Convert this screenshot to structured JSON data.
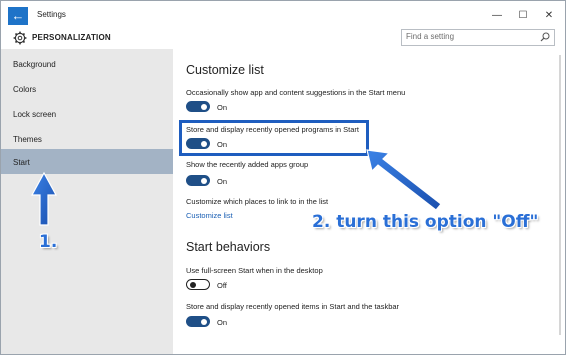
{
  "window": {
    "title": "Settings",
    "controls": {
      "minimize": "—",
      "maximize": "☐",
      "close": "✕"
    }
  },
  "header": {
    "title": "PERSONALIZATION",
    "search_placeholder": "Find a setting"
  },
  "sidebar": {
    "items": [
      {
        "label": "Background"
      },
      {
        "label": "Colors"
      },
      {
        "label": "Lock screen"
      },
      {
        "label": "Themes"
      },
      {
        "label": "Start",
        "active": true
      }
    ]
  },
  "main": {
    "customize_title": "Customize list",
    "settings": [
      {
        "label": "Occasionally show app and content suggestions in the Start menu",
        "state": "On"
      },
      {
        "label": "Store and display recently opened programs in Start",
        "state": "On"
      },
      {
        "label": "Show the recently added apps group",
        "state": "On"
      }
    ],
    "places_label": "Customize which places to link to in the list",
    "places_link": "Customize list",
    "behaviors_title": "Start behaviors",
    "behaviors": [
      {
        "label": "Use full-screen Start when in the desktop",
        "state": "Off"
      },
      {
        "label": "Store and display recently opened items in Start and the taskbar",
        "state": "On"
      }
    ]
  },
  "annotations": {
    "step1": "1.",
    "step2": "2. turn this option \"Off\""
  },
  "colors": {
    "accent": "#1e73c8",
    "toggle_on": "#1f4f87",
    "sidebar_bg": "#e8e8e8",
    "sidebar_active": "#a3b3c5",
    "annotation": "#2a6fd6",
    "link": "#1a5fb4"
  },
  "icons": {
    "back": "back-arrow-icon",
    "settings": "gear-icon",
    "search": "search-icon"
  }
}
